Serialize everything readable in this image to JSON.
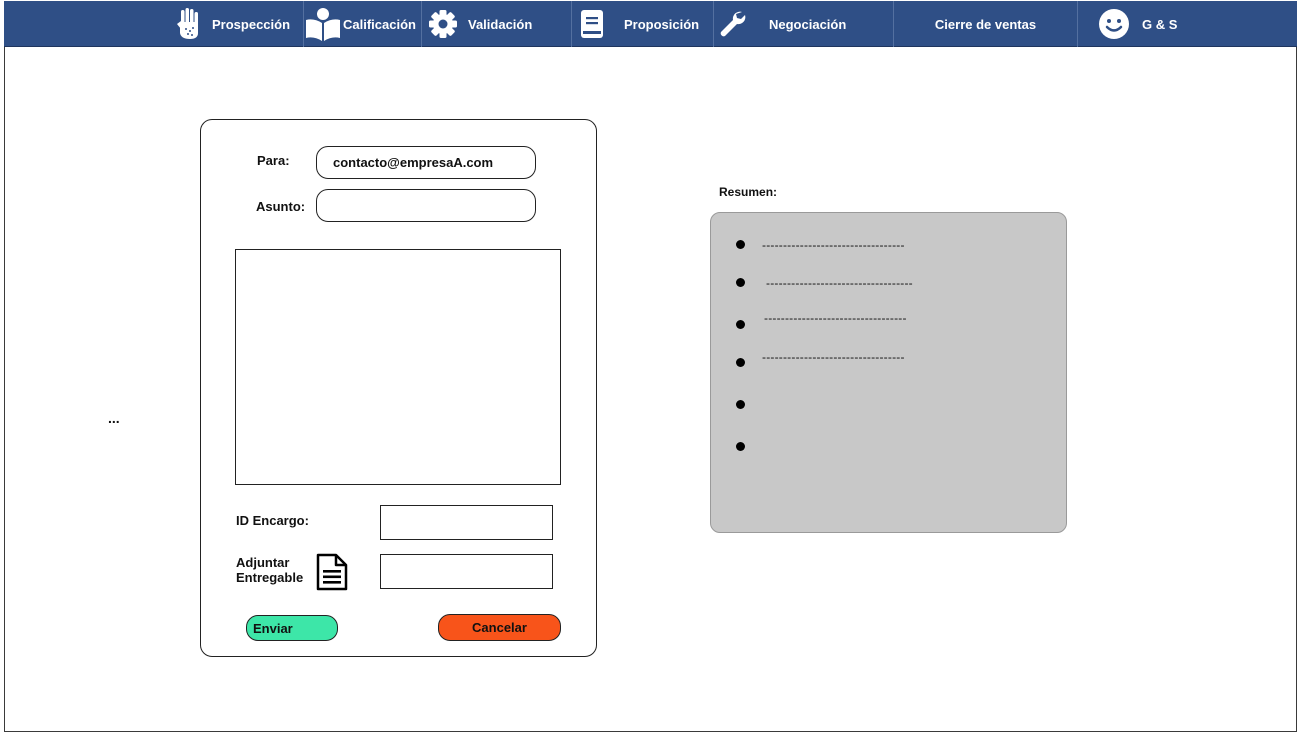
{
  "nav": {
    "items": [
      {
        "label": "Prospección",
        "icon": "hand-icon"
      },
      {
        "label": "Calificación",
        "icon": "book-reader-icon"
      },
      {
        "label": "Validación",
        "icon": "gear-icon"
      },
      {
        "label": "Proposición",
        "icon": "document-icon"
      },
      {
        "label": "Negociación",
        "icon": "wrench-icon"
      },
      {
        "label": "Cierre de ventas",
        "icon": ""
      },
      {
        "label": "G & S",
        "icon": "smiley-icon"
      }
    ],
    "color": "#2f4f86"
  },
  "side": {
    "ellipsis": "..."
  },
  "form": {
    "to_label": "Para:",
    "to_value": "contacto@empresaA.com",
    "subject_label": "Asunto:",
    "subject_value": "",
    "body_value": "",
    "order_id_label": "ID Encargo:",
    "attach_label_line1": "Adjuntar",
    "attach_label_line2": "Entregable",
    "send_label": "Enviar",
    "send_color": "#3de6a8",
    "cancel_label": "Cancelar",
    "cancel_color": "#f8541a"
  },
  "summary": {
    "title": "Resumen:",
    "items": [
      "----------------------------------",
      "-----------------------------------",
      "----------------------------------",
      "----------------------------------",
      "",
      ""
    ],
    "bg_color": "#c8c8c8"
  }
}
